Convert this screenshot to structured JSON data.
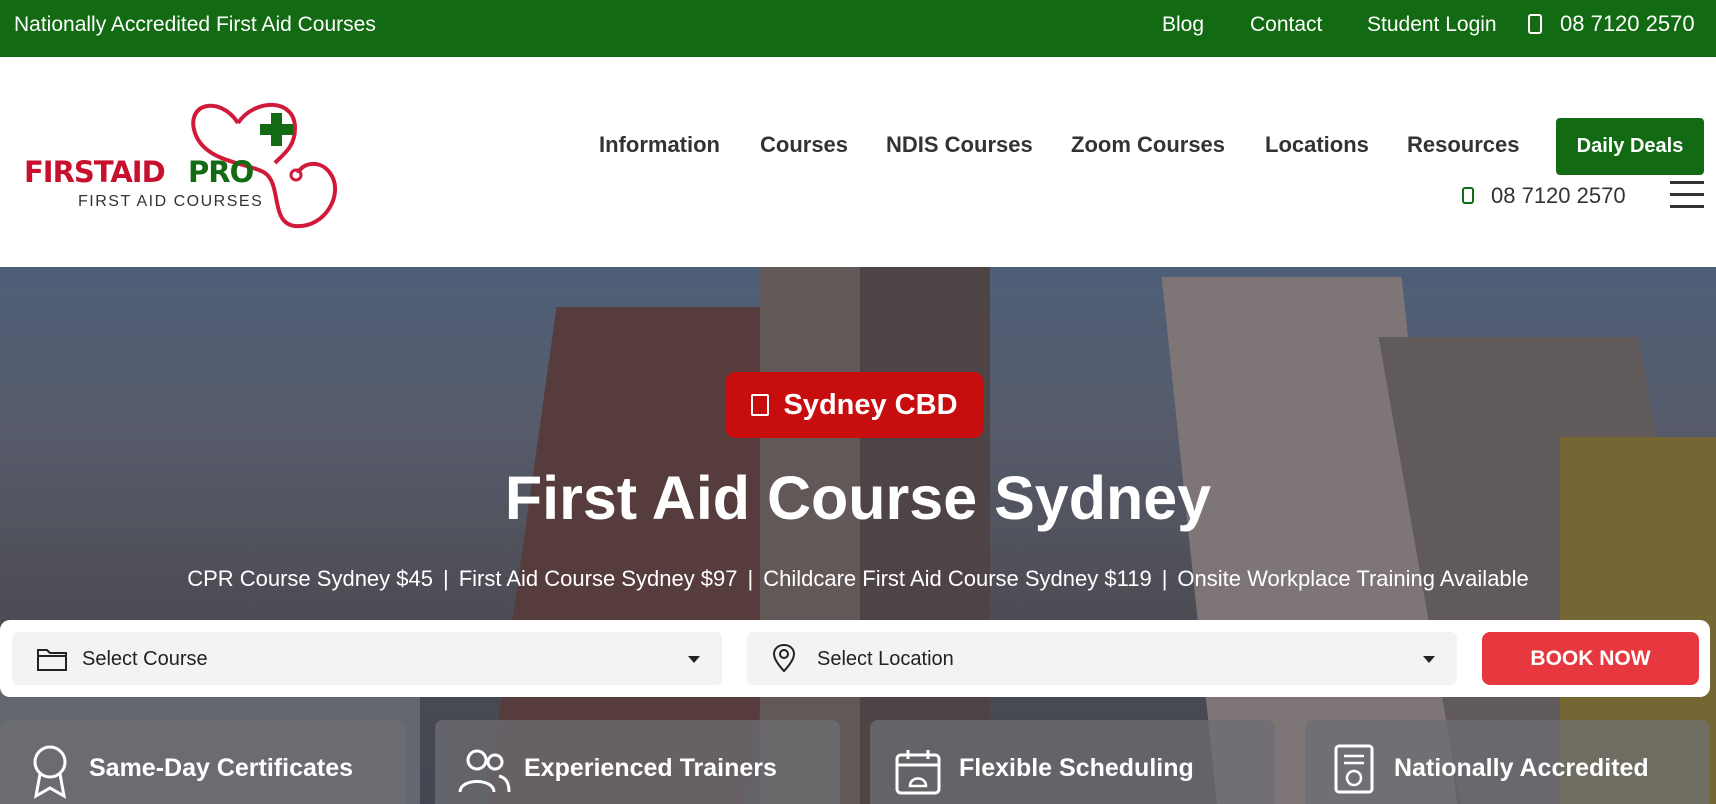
{
  "topbar": {
    "tagline": "Nationally Accredited First Aid Courses",
    "links": [
      "Blog",
      "Contact",
      "Student Login"
    ],
    "phone": "08 7120 2570",
    "bg_color": "#126b13"
  },
  "logo": {
    "word1": "FIRSTAID",
    "word2": "PRO",
    "subtitle": "FIRST AID COURSES"
  },
  "nav": {
    "items": [
      "Information",
      "Courses",
      "NDIS Courses",
      "Zoom Courses",
      "Locations",
      "Resources"
    ],
    "cta": "Daily Deals",
    "phone": "08 7120 2570"
  },
  "hero": {
    "location_badge": "Sydney CBD",
    "title": "First Aid Course Sydney",
    "prices": [
      "CPR Course Sydney $45",
      "First Aid Course Sydney $97",
      "Childcare First Aid Course Sydney $119",
      "Onsite Workplace Training Available"
    ]
  },
  "booking": {
    "course_placeholder": "Select Course",
    "location_placeholder": "Select Location",
    "button": "BOOK NOW",
    "button_color": "#e8383f"
  },
  "features": [
    {
      "icon": "award-ribbon-icon",
      "label": "Same-Day Certificates"
    },
    {
      "icon": "users-icon",
      "label": "Experienced Trainers"
    },
    {
      "icon": "calendar-icon",
      "label": "Flexible Scheduling"
    },
    {
      "icon": "certificate-icon",
      "label": "Nationally Accredited"
    }
  ]
}
